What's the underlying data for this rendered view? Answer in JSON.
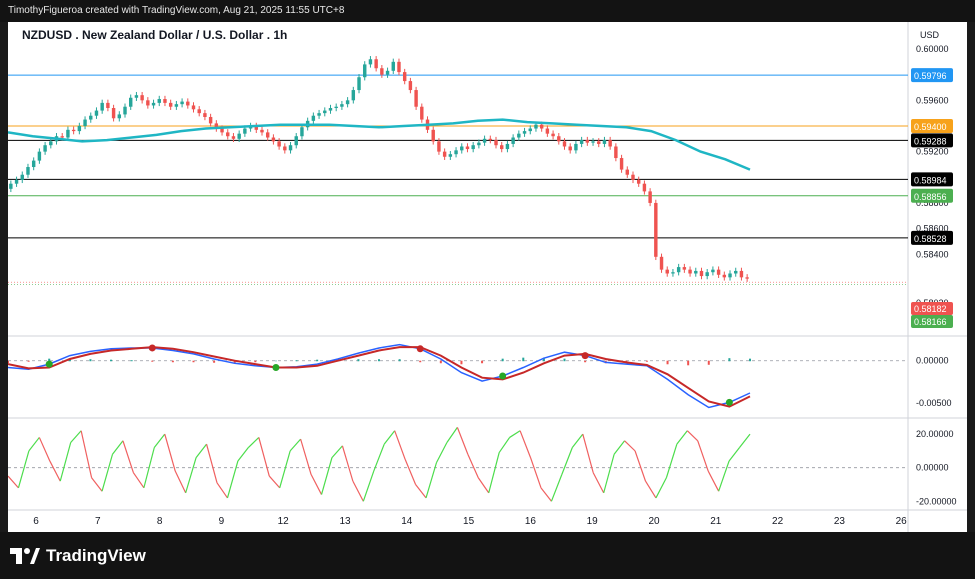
{
  "watermark": "TimothyFigueroa created with TradingView.com, Aug 21, 2025 11:55 UTC+8",
  "brand": {
    "name": "TradingView",
    "icon": "tradingview-logo-icon"
  },
  "colors": {
    "up": "#26a69a",
    "down": "#ef5350",
    "ma": "#1fb6c4",
    "line_blue": "#2196f3",
    "line_orange": "#f7a21b",
    "line_black": "#000000",
    "line_green": "#4caf50",
    "wt_green": "#27a727",
    "wt_red": "#c62828",
    "wt_blue": "#2962ff",
    "rsi_green": "#4cdd4c",
    "rsi_red": "#f06060"
  },
  "chart_data": {
    "type": "candlestick",
    "title": "NZDUSD . New Zealand Dollar / U.S. Dollar . 1h",
    "currency": "USD",
    "x_ticks": [
      "6",
      "7",
      "8",
      "9",
      "12",
      "13",
      "14",
      "15",
      "16",
      "19",
      "20",
      "21",
      "22",
      "23",
      "26"
    ],
    "y_ticks_main": [
      "0.60000",
      "0.59600",
      "0.59200",
      "0.58800",
      "0.58600",
      "0.58400",
      "0.58020"
    ],
    "horizontal_levels": [
      {
        "label": "0.59796",
        "value": 0.59796,
        "color": "#2196f3"
      },
      {
        "label": "0.59400",
        "value": 0.594,
        "color": "#f7a21b"
      },
      {
        "label": "0.59288",
        "value": 0.59288,
        "color": "#000000"
      },
      {
        "label": "0.58984",
        "value": 0.58984,
        "color": "#000000"
      },
      {
        "label": "0.58856",
        "value": 0.58856,
        "color": "#4caf50"
      },
      {
        "label": "0.58528",
        "value": 0.58528,
        "color": "#000000"
      }
    ],
    "price_badges": [
      {
        "label": "0.58182",
        "value": 0.58182,
        "color": "#ef5350"
      },
      {
        "label": "0.58166",
        "value": 0.58166,
        "color": "#4caf50"
      }
    ],
    "close_series": [
      0.5895,
      0.5898,
      0.5902,
      0.5908,
      0.5913,
      0.592,
      0.5925,
      0.5928,
      0.5932,
      0.5931,
      0.5937,
      0.5936,
      0.594,
      0.5945,
      0.5948,
      0.5952,
      0.5958,
      0.5954,
      0.5946,
      0.5949,
      0.5955,
      0.5962,
      0.5964,
      0.596,
      0.5956,
      0.5958,
      0.5961,
      0.5958,
      0.5955,
      0.5957,
      0.5959,
      0.5956,
      0.5953,
      0.595,
      0.5947,
      0.5942,
      0.5938,
      0.5935,
      0.5932,
      0.593,
      0.5934,
      0.5938,
      0.594,
      0.5937,
      0.5935,
      0.5931,
      0.5928,
      0.5924,
      0.5921,
      0.5925,
      0.5932,
      0.5939,
      0.5944,
      0.5948,
      0.595,
      0.5952,
      0.5954,
      0.5955,
      0.5957,
      0.596,
      0.5968,
      0.5978,
      0.5988,
      0.5992,
      0.5985,
      0.598,
      0.5983,
      0.599,
      0.5982,
      0.5975,
      0.5968,
      0.5955,
      0.5945,
      0.5937,
      0.5928,
      0.592,
      0.5916,
      0.5918,
      0.5921,
      0.5924,
      0.5922,
      0.5925,
      0.5927,
      0.593,
      0.5929,
      0.5925,
      0.5922,
      0.5926,
      0.5931,
      0.5934,
      0.5936,
      0.5938,
      0.5941,
      0.5938,
      0.5934,
      0.5932,
      0.5928,
      0.5924,
      0.5921,
      0.5926,
      0.5929,
      0.5927,
      0.5928,
      0.5926,
      0.5929,
      0.5924,
      0.5915,
      0.5906,
      0.5902,
      0.5898,
      0.5895,
      0.5889,
      0.588,
      0.5838,
      0.5828,
      0.5825,
      0.5826,
      0.583,
      0.5828,
      0.5825,
      0.5827,
      0.5823,
      0.5826,
      0.5828,
      0.5824,
      0.5822,
      0.5825,
      0.5827,
      0.5822,
      0.5821
    ],
    "ma_series": [
      0.5935,
      0.5932,
      0.593,
      0.5928,
      0.5929,
      0.5931,
      0.5933,
      0.5936,
      0.5938,
      0.5939,
      0.594,
      0.5941,
      0.5941,
      0.5941,
      0.594,
      0.5939,
      0.594,
      0.5941,
      0.5942,
      0.5944,
      0.5945,
      0.5943,
      0.5942,
      0.5941,
      0.594,
      0.5939,
      0.5936,
      0.5929,
      0.592,
      0.5914,
      0.5906
    ],
    "indicator1": {
      "y_ticks": [
        "0.00000",
        "-0.00500"
      ],
      "y_range": [
        -0.0065,
        0.0022
      ],
      "green_line": [
        -0.0008,
        -0.001,
        -0.0004,
        0.0006,
        0.0011,
        0.0014,
        0.0015,
        0.0015,
        0.0012,
        0.0008,
        0.0002,
        -0.0003,
        -0.0006,
        -0.0008,
        -0.0007,
        -0.0004,
        0.0002,
        0.0009,
        0.0015,
        0.0019,
        0.0014,
        0.0002,
        -0.0014,
        -0.0024,
        -0.0018,
        -0.0008,
        0.0003,
        0.001,
        0.0006,
        -0.0002,
        -0.0004,
        -0.0006,
        -0.0022,
        -0.004,
        -0.0055,
        -0.0049,
        -0.0038
      ],
      "red_line": [
        -0.0004,
        -0.0009,
        -0.0008,
        0.0002,
        0.0008,
        0.0012,
        0.0014,
        0.0016,
        0.0014,
        0.001,
        0.0005,
        0.0,
        -0.0004,
        -0.0008,
        -0.0008,
        -0.0006,
        0.0,
        0.0006,
        0.0012,
        0.0016,
        0.0016,
        0.0006,
        -0.0008,
        -0.002,
        -0.0022,
        -0.0014,
        -0.0003,
        0.0006,
        0.0008,
        0.0002,
        -0.0002,
        -0.0005,
        -0.0016,
        -0.0032,
        -0.0048,
        -0.0054,
        -0.0042
      ]
    },
    "indicator2": {
      "y_ticks": [
        "20.00000",
        "0.00000",
        "-20.00000"
      ],
      "y_range": [
        -24,
        26
      ],
      "values": [
        -5,
        -12,
        10,
        18,
        4,
        -8,
        15,
        22,
        -6,
        -14,
        8,
        16,
        -3,
        -12,
        12,
        20,
        -2,
        -15,
        6,
        14,
        -9,
        -18,
        4,
        12,
        18,
        -5,
        -12,
        10,
        17,
        -4,
        -16,
        6,
        13,
        -8,
        -20,
        -2,
        14,
        22,
        5,
        -10,
        -18,
        3,
        15,
        24,
        8,
        -6,
        -15,
        9,
        18,
        22,
        6,
        -12,
        -20,
        -4,
        12,
        20,
        -3,
        -15,
        8,
        16,
        10,
        -8,
        -18,
        -6,
        14,
        22,
        16,
        -2,
        -14,
        4,
        12,
        20
      ]
    }
  }
}
